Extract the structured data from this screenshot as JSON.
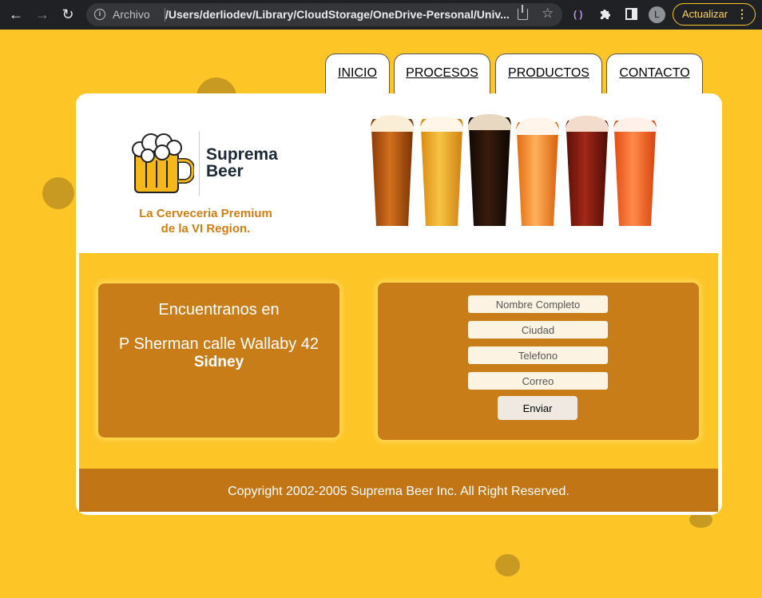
{
  "browser": {
    "scheme_label": "Archivo",
    "url": "/Users/derliodev/Library/CloudStorage/OneDrive-Personal/Univ...",
    "profile_initial": "L",
    "update_label": "Actualizar",
    "accent_color": "#fdc526"
  },
  "nav": {
    "tabs": [
      {
        "label": "INICIO"
      },
      {
        "label": "PROCESOS"
      },
      {
        "label": "PRODUCTOS"
      },
      {
        "label": "CONTACTO"
      }
    ]
  },
  "header": {
    "logo_line1": "Suprema",
    "logo_line2": "Beer",
    "tagline_line1": "La Cerveceria Premium",
    "tagline_line2": "de la VI Region."
  },
  "location": {
    "title": "Encuentranos en",
    "address": "P Sherman calle Wallaby 42",
    "city": "Sidney"
  },
  "form": {
    "name_placeholder": "Nombre Completo",
    "city_placeholder": "Ciudad",
    "phone_placeholder": "Telefono",
    "email_placeholder": "Correo",
    "submit_label": "Enviar"
  },
  "footer": {
    "copyright": "Copyright 2002-2005 Suprema Beer Inc. All Right Reserved."
  },
  "colors": {
    "page_bg": "#fdc526",
    "card_bg": "#c97d18",
    "footer_bg": "#c27514",
    "tagline": "#d07d12"
  },
  "icons": {
    "back": "arrow-left-icon",
    "forward": "arrow-right-icon",
    "reload": "reload-icon",
    "info": "info-icon",
    "share": "share-icon",
    "bookmark": "star-icon",
    "extensions": "puzzle-icon",
    "sidebar": "sidebar-icon",
    "menu": "more-vertical-icon"
  }
}
